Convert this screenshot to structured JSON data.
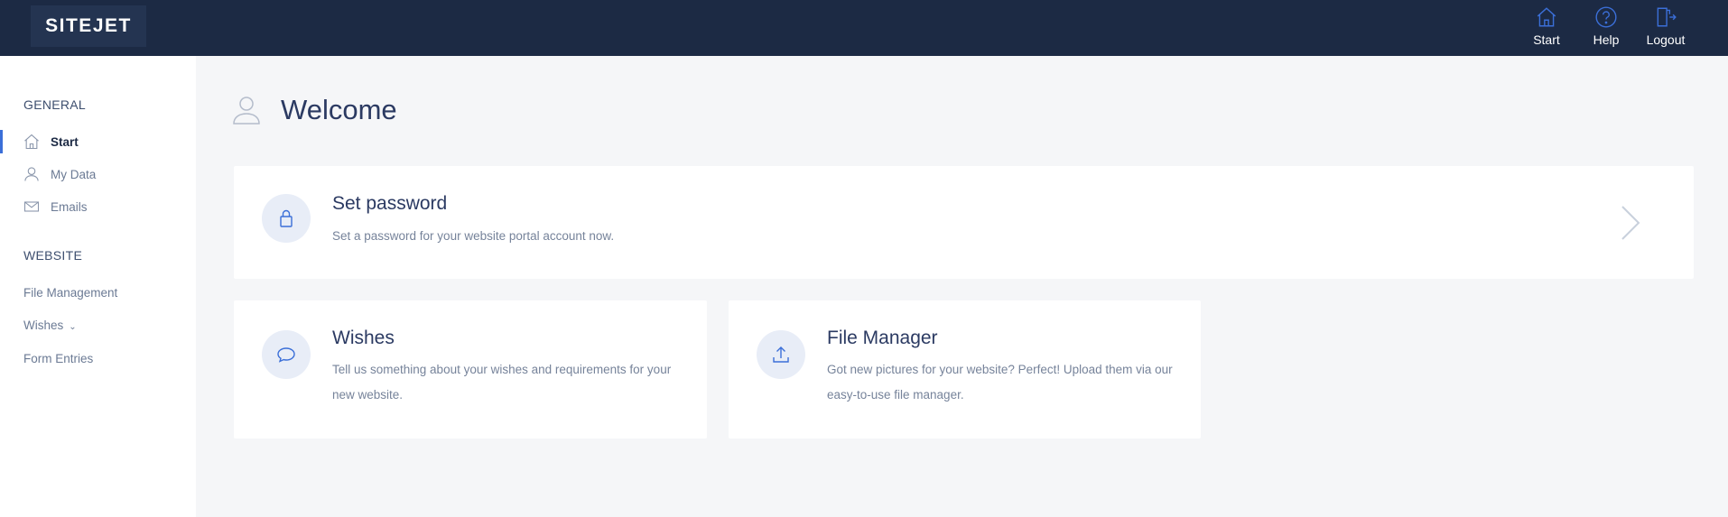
{
  "header": {
    "logo_text": "SITEJET",
    "nav": [
      {
        "label": "Start",
        "icon": "home-icon"
      },
      {
        "label": "Help",
        "icon": "help-icon"
      },
      {
        "label": "Logout",
        "icon": "logout-icon"
      }
    ]
  },
  "sidebar": {
    "general_heading": "GENERAL",
    "general_items": [
      {
        "label": "Start",
        "icon": "home-icon",
        "active": true
      },
      {
        "label": "My Data",
        "icon": "user-icon",
        "active": false
      },
      {
        "label": "Emails",
        "icon": "mail-icon",
        "active": false
      }
    ],
    "website_heading": "WEBSITE",
    "website_items": [
      {
        "label": "File Management"
      },
      {
        "label": "Wishes"
      },
      {
        "label": "Form Entries"
      }
    ]
  },
  "main": {
    "title": "Welcome",
    "cards": {
      "password": {
        "title": "Set password",
        "description": "Set a password for your website portal account now.",
        "icon": "lock-icon"
      },
      "wishes": {
        "title": "Wishes",
        "description_line1": "Tell us something about your wishes and requirements for your",
        "description_line2": "new website.",
        "icon": "chat-bubble-icon"
      },
      "file_manager": {
        "title": "File Manager",
        "description_line1": "Got new pictures for your website? Perfect! Upload them via our",
        "description_line2": "easy-to-use file manager.",
        "icon": "upload-icon"
      }
    }
  },
  "colors": {
    "topbar": "#1c2a44",
    "accent": "#3b6fd8",
    "background": "#f5f6f8"
  }
}
